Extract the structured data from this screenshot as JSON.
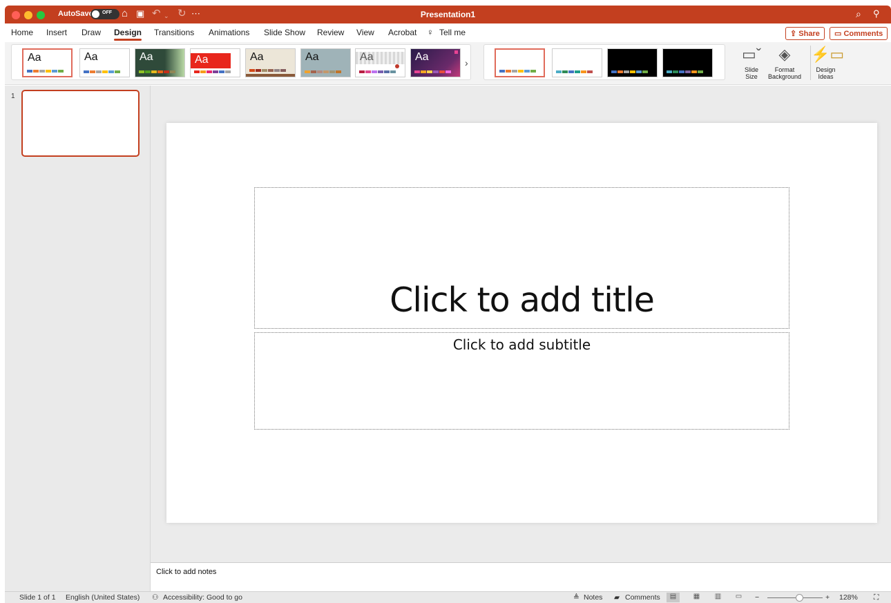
{
  "window": {
    "title": "Presentation1",
    "autosave_label": "AutoSave",
    "autosave_state": "OFF"
  },
  "titlebar_icons": [
    "home-icon",
    "save-icon",
    "undo-icon",
    "redo-icon",
    "more-icon",
    "search-icon",
    "account-icon"
  ],
  "tabs": [
    "Home",
    "Insert",
    "Draw",
    "Design",
    "Transitions",
    "Animations",
    "Slide Show",
    "Review",
    "View",
    "Acrobat",
    "Tell me"
  ],
  "active_tab": "Design",
  "share_label": "Share",
  "comments_label": "Comments",
  "theme_sample_text": "Aa",
  "themes": [
    {
      "name": "office-theme",
      "bg": "#ffffff",
      "text": "#111111",
      "selected": true
    },
    {
      "name": "office-theme-2",
      "bg": "#ffffff",
      "text": "#111111",
      "selected": false
    },
    {
      "name": "facet",
      "bg": "#2f4a3a",
      "text": "#ffffff",
      "selected": false
    },
    {
      "name": "red-banner",
      "bg": "#ffffff",
      "text": "#ffffff",
      "selected": false
    },
    {
      "name": "wood-type",
      "bg": "#e8e2d4",
      "text": "#111111",
      "selected": false
    },
    {
      "name": "slate",
      "bg": "#9fb3b8",
      "text": "#111111",
      "selected": false
    },
    {
      "name": "gallery",
      "bg": "#ffffff",
      "text": "#555555",
      "selected": false
    },
    {
      "name": "celestial",
      "bg": "#2a1b4a",
      "text": "#ffffff",
      "selected": false
    }
  ],
  "variants": [
    {
      "bg": "#ffffff",
      "selected": true
    },
    {
      "bg": "#ffffff",
      "selected": false
    },
    {
      "bg": "#000000",
      "selected": false
    },
    {
      "bg": "#000000",
      "selected": false
    }
  ],
  "ribbon_buttons": {
    "slide_size": [
      "Slide",
      "Size"
    ],
    "format_background": [
      "Format",
      "Background"
    ],
    "design_ideas": [
      "Design",
      "Ideas"
    ]
  },
  "slide_panel": {
    "slide_number": "1"
  },
  "slide": {
    "title_placeholder": "Click to add title",
    "subtitle_placeholder": "Click to add subtitle"
  },
  "notes_placeholder": "Click to add notes",
  "status": {
    "slide_of": "Slide 1 of 1",
    "language": "English (United States)",
    "accessibility": "Accessibility: Good to go",
    "notes_label": "Notes",
    "comments_label": "Comments",
    "zoom": "128%"
  },
  "colors": {
    "accent": "#c33f1f",
    "swatch_row": [
      "#4472c4",
      "#ed7d31",
      "#a5a5a5",
      "#ffc000",
      "#5b9bd5",
      "#70ad47"
    ]
  }
}
